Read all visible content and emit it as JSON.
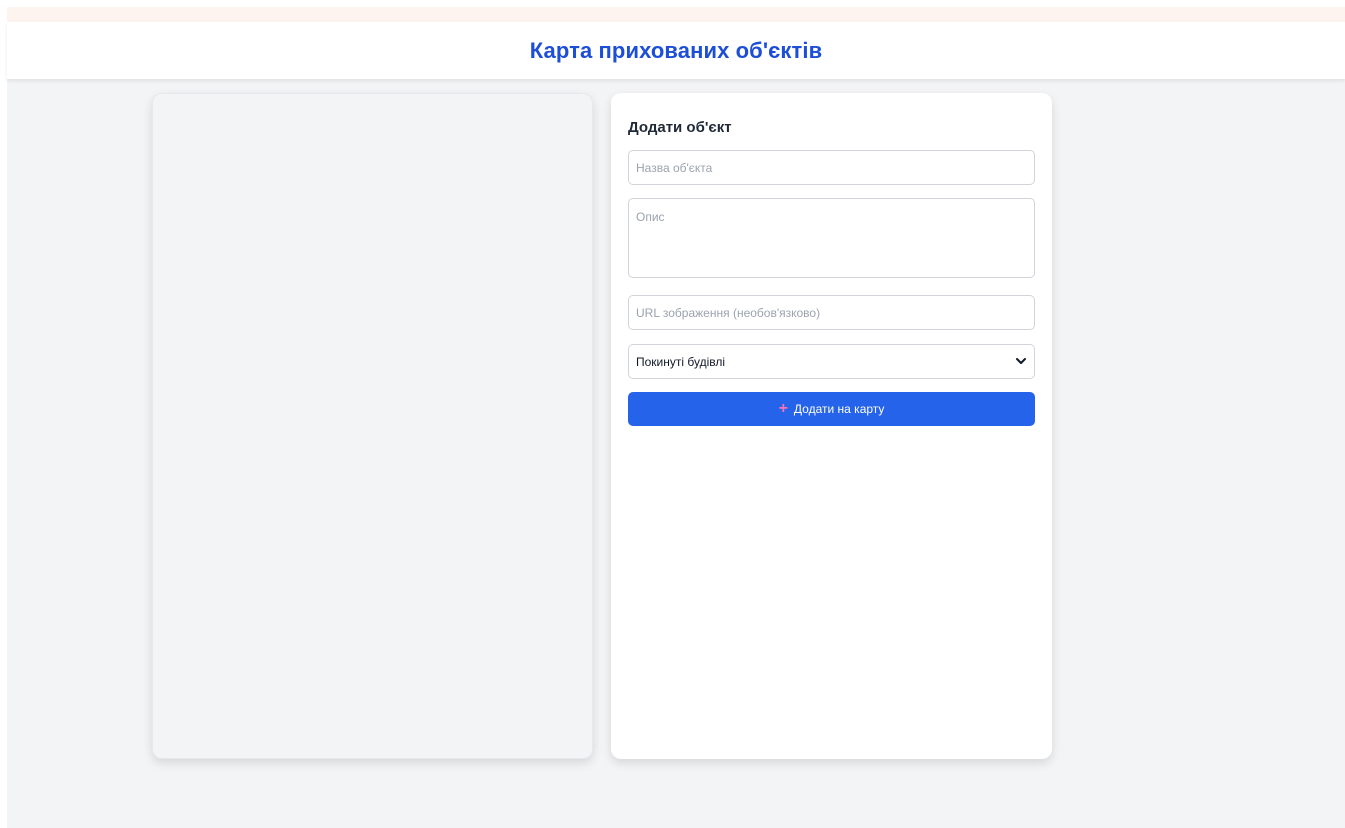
{
  "header": {
    "title": "Карта прихованих об'єктів"
  },
  "form": {
    "title": "Додати об'єкт",
    "name_placeholder": "Назва об'єкта",
    "description_placeholder": "Опис",
    "image_url_placeholder": "URL зображення (необов'язково)",
    "category_selected": "Покинуті будівлі",
    "submit_label": "Додати на карту",
    "submit_icon": "plus-icon"
  },
  "colors": {
    "accent": "#2563eb",
    "title": "#1d4ed8",
    "background": "#f3f4f6",
    "plus_icon": "#f472b6"
  }
}
